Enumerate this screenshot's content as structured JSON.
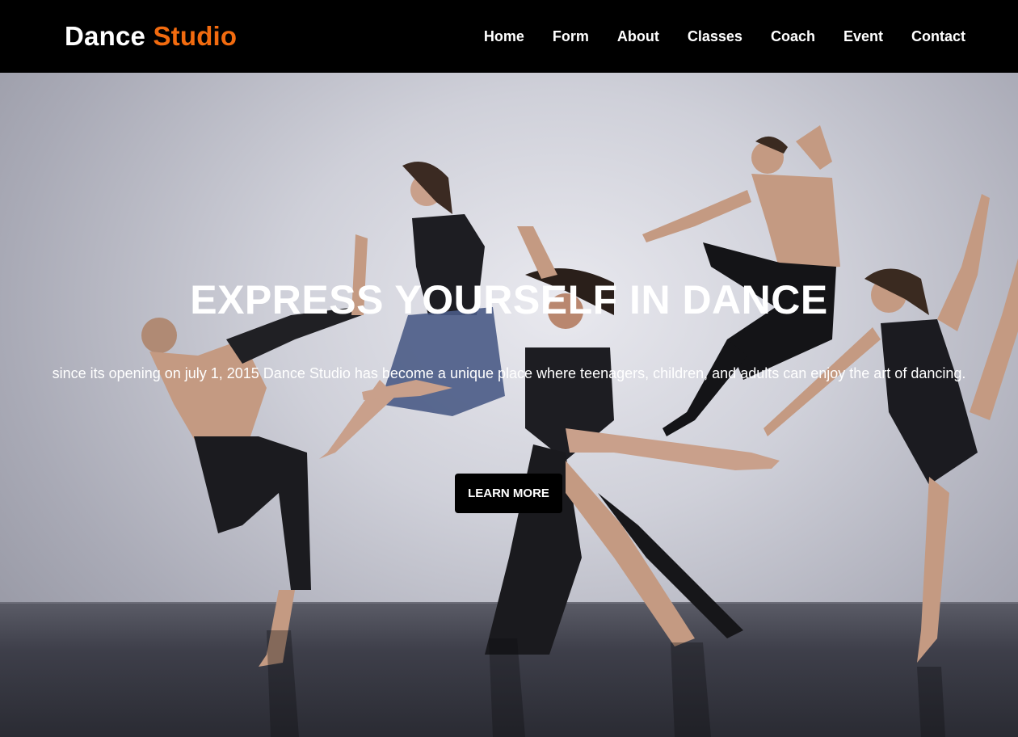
{
  "navbar": {
    "brand_primary": "Dance",
    "brand_accent": "Studio",
    "links": [
      "Home",
      "Form",
      "About",
      "Classes",
      "Coach",
      "Event",
      "Contact"
    ]
  },
  "hero": {
    "title": "EXPRESS YOURSELF IN DANCE",
    "subtitle": "since its opening on july 1, 2015 Dance Studio has become a unique place where teenagers, children, and adults can enjoy the art of dancing.",
    "cta_label": "LEARN MORE"
  },
  "colors": {
    "navbar_bg": "#000000",
    "brand_accent": "#f26b0f",
    "text": "#ffffff",
    "button_bg": "#000000"
  }
}
